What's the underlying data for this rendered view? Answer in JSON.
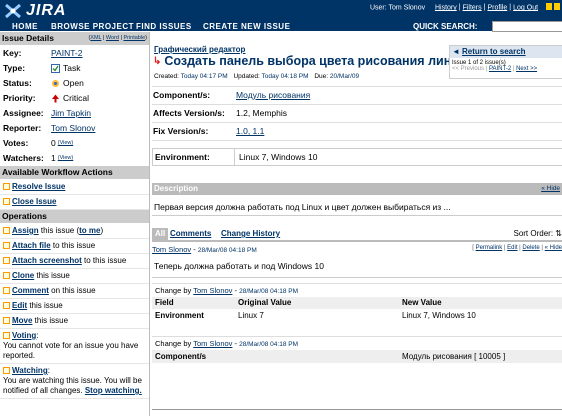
{
  "app": {
    "name": "JIRA"
  },
  "header": {
    "user_text": "User: Tom Slonov",
    "links": [
      "History",
      "Filters",
      "Profile",
      "Log Out"
    ],
    "nav": [
      "HOME",
      "BROWSE PROJECT",
      "FIND ISSUES",
      "CREATE NEW ISSUE"
    ],
    "quick_search_label": "QUICK SEARCH:",
    "quick_search_value": ""
  },
  "sidebar": {
    "details_title": "Issue Details",
    "formats": [
      "XML",
      "Word",
      "Printable"
    ],
    "fields": [
      {
        "key": "Key:",
        "value": "PAINT-2",
        "link": true,
        "icon": ""
      },
      {
        "key": "Type:",
        "value": "Task",
        "link": false,
        "icon": "task-icon"
      },
      {
        "key": "Status:",
        "value": "Open",
        "link": false,
        "icon": "open-status-icon"
      },
      {
        "key": "Priority:",
        "value": "Critical",
        "link": false,
        "icon": "critical-priority-icon"
      },
      {
        "key": "Assignee:",
        "value": "Jim Tapkin",
        "link": true,
        "icon": ""
      },
      {
        "key": "Reporter:",
        "value": "Tom Slonov",
        "link": true,
        "icon": ""
      },
      {
        "key": "Votes:",
        "value": "0",
        "link": false,
        "icon": "",
        "extra": "(View)"
      },
      {
        "key": "Watchers:",
        "value": "1",
        "link": false,
        "icon": "",
        "extra": "(View)"
      }
    ],
    "workflow_title": "Available Workflow Actions",
    "workflow_actions": [
      "Resolve Issue",
      "Close Issue"
    ],
    "operations_title": "Operations",
    "operations": [
      {
        "link": "Assign",
        "text": " this issue (",
        "link2": "to me",
        "text2": ")"
      },
      {
        "link": "Attach file",
        "text": " to this issue"
      },
      {
        "link": "Attach screenshot",
        "text": " to this issue"
      },
      {
        "link": "Clone",
        "text": " this issue"
      },
      {
        "link": "Comment",
        "text": " on this issue"
      },
      {
        "link": "Edit",
        "text": " this issue"
      },
      {
        "link": "Move",
        "text": " this issue"
      }
    ],
    "voting": {
      "link": "Voting",
      "note": "You cannot vote for an issue you have reported."
    },
    "watching": {
      "link": "Watching",
      "note": "You are watching this issue. You will be notified of all changes.",
      "stop": "Stop watching."
    }
  },
  "main": {
    "breadcrumb": "Графический редактор",
    "title": "Создать панель выбора цвета рисования линии",
    "created_label": "Created:",
    "created_value": "Today 04:17 PM",
    "updated_label": "Updated:",
    "updated_value": "Today 04:18 PM",
    "due_label": "Due:",
    "due_value": "20/Mar/09",
    "return_search": "Return to search",
    "issue_count": "Issue 1 of 2 issue(s)",
    "prev": "<< Previous",
    "current_key": "PAINT-2",
    "next": "Next >>",
    "fields": [
      {
        "key": "Component/s:",
        "value": "Модуль рисования"
      },
      {
        "key": "Affects Version/s:",
        "value": "1.2, Memphis"
      },
      {
        "key": "Fix Version/s:",
        "value": "1.0, 1.1"
      }
    ],
    "environment_label": "Environment:",
    "environment_value": "Linux 7, Windows 10",
    "description_title": "Description",
    "description_hide": "« Hide",
    "description_text": "Первая версия должна работать под Linux и цвет должен выбираться из ...",
    "tabs": [
      "All",
      "Comments",
      "Change History"
    ],
    "sort_label": "Sort Order:",
    "comment": {
      "author": "Tom Slonov",
      "date": "28/Mar/08 04:18 PM",
      "links": [
        "Permalink",
        "Edit",
        "Delete",
        "« Hide"
      ],
      "body": "Теперь должна работать и под Windows 10"
    },
    "changes": [
      {
        "by_label": "Change by",
        "author": "Tom Slonov",
        "date": "28/Mar/08 04:18 PM",
        "headers": [
          "Field",
          "Original Value",
          "New Value"
        ],
        "rows": [
          {
            "field": "Environment",
            "original": "Linux 7",
            "new": "Linux 7, Windows 10"
          }
        ]
      },
      {
        "by_label": "Change by",
        "author": "Tom Slonov",
        "date": "28/Mar/08 04:18 PM",
        "rows": [
          {
            "field": "Component/s",
            "original": "",
            "new": "Модуль рисования [ 10005 ]"
          }
        ]
      }
    ]
  },
  "colors": {
    "header_bg": "#003366",
    "link": "#003366",
    "section_bg": "#cccccc"
  }
}
